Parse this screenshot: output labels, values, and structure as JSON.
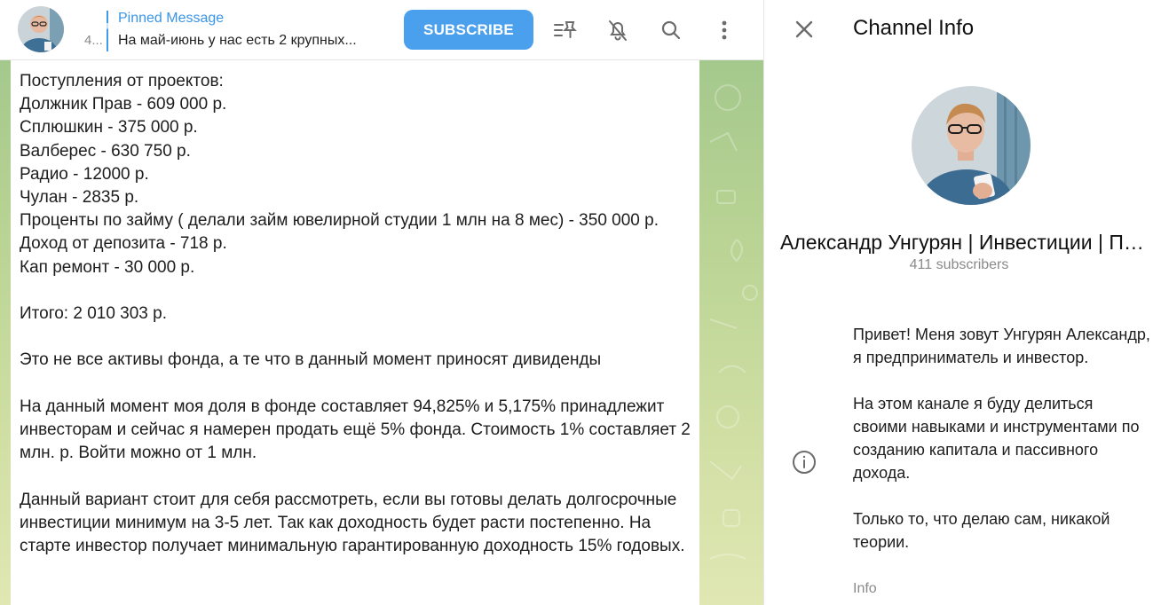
{
  "pinned": {
    "count": "4...",
    "title": "Pinned Message",
    "text": "На май-июнь у нас есть 2 крупных..."
  },
  "toolbar": {
    "subscribe_label": "SUBSCRIBE",
    "icons": [
      "pinned-list-icon",
      "mute-bell-icon",
      "search-icon",
      "more-vertical-icon"
    ]
  },
  "message": {
    "lines": [
      "Поступления от проектов:",
      "Должник Прав - 609 000 р.",
      "Сплюшкин - 375 000 р.",
      "Валберес - 630 750 р.",
      "Радио - 12000 р.",
      "Чулан - 2835 р.",
      "Проценты по займу ( делали займ ювелирной студии 1 млн на 8 мес) - 350 000 р.",
      "Доход от депозита - 718 р.",
      "Кап ремонт - 30 000 р.",
      "",
      "Итого: 2 010 303 р.",
      "",
      "Это не все активы фонда, а те что в данный момент приносят дивиденды",
      "",
      "На данный момент моя доля в фонде составляет 94,825% и 5,175% принадлежит инвесторам и сейчас я намерен продать ещё 5% фонда. Стоимость 1% составляет 2 млн. р. Войти можно от 1 млн.",
      "",
      "Данный вариант стоит для себя рассмотреть, если вы готовы делать долгосрочные инвестиции минимум на 3-5 лет. Так как доходность будет расти постепенно. На старте инвестор получает минимальную гарантированную доходность 15% годовых."
    ]
  },
  "info_panel": {
    "title": "Channel Info",
    "channel_name": "Александр Унгурян | Инвестиции | Пассивный доход",
    "subscribers": "411 subscribers",
    "description": [
      "Привет! Меня зовут Унгурян Александр, я предприниматель и инвестор.",
      "На этом канале я буду делиться своими навыками и инструментами по созданию капитала и пассивного дохода.",
      "Только то, что делаю сам, никакой теории."
    ],
    "description_caption": "Info"
  },
  "colors": {
    "accent": "#4aa0ec",
    "pin_title": "#3a95e8",
    "chat_bg": "#b6d293"
  }
}
